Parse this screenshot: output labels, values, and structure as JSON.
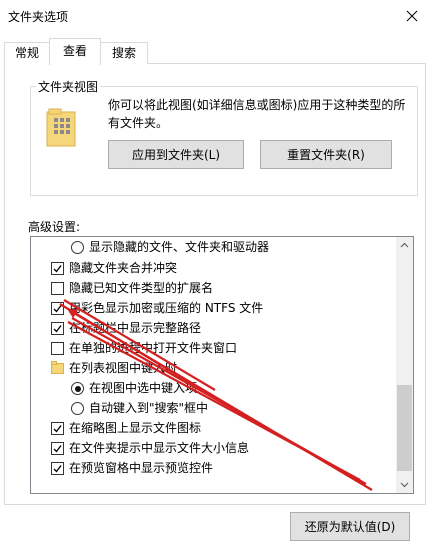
{
  "window": {
    "title": "文件夹选项"
  },
  "tabs": [
    {
      "label": "常规"
    },
    {
      "label": "查看"
    },
    {
      "label": "搜索"
    }
  ],
  "folder_view": {
    "legend": "文件夹视图",
    "description": "你可以将此视图(如详细信息或图标)应用于这种类型的所有文件夹。",
    "apply_button": "应用到文件夹(L)",
    "reset_button": "重置文件夹(R)"
  },
  "advanced": {
    "label": "高级设置:",
    "items": [
      {
        "text": "显示隐藏的文件、文件夹和驱动器",
        "type": "radio",
        "checked": false
      },
      {
        "text": "隐藏文件夹合并冲突",
        "type": "checkbox",
        "checked": true
      },
      {
        "text": "隐藏已知文件类型的扩展名",
        "type": "checkbox",
        "checked": false
      },
      {
        "text": "用彩色显示加密或压缩的 NTFS 文件",
        "type": "checkbox",
        "checked": true
      },
      {
        "text": "在标题栏中显示完整路径",
        "type": "checkbox",
        "checked": true
      },
      {
        "text": "在单独的进程中打开文件夹窗口",
        "type": "checkbox",
        "checked": false
      },
      {
        "text": "在列表视图中键入时",
        "type": "folder",
        "checked": false
      },
      {
        "text": "在视图中选中键入项",
        "type": "radio",
        "checked": true
      },
      {
        "text": "自动键入到\"搜索\"框中",
        "type": "radio",
        "checked": false
      },
      {
        "text": "在缩略图上显示文件图标",
        "type": "checkbox",
        "checked": true
      },
      {
        "text": "在文件夹提示中显示文件大小信息",
        "type": "checkbox",
        "checked": true
      },
      {
        "text": "在预览窗格中显示预览控件",
        "type": "checkbox",
        "checked": true
      }
    ],
    "restore_button": "还原为默认值(D)"
  },
  "colors": {
    "annotation_arrow": "#d42020",
    "button_bg": "#e1e1e1",
    "border": "#d9d9d9"
  }
}
